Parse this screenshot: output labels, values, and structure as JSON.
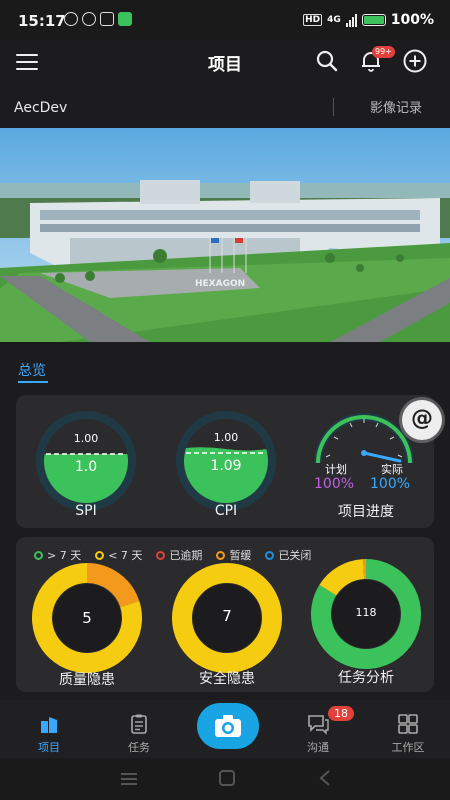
{
  "status_bar": {
    "time": "15:17",
    "battery_text": "100%",
    "hd_label": "HD",
    "network_label": "4G"
  },
  "header": {
    "title": "项目",
    "notification_badge": "99+"
  },
  "project_bar": {
    "name": "AecDev",
    "video_record": "影像记录"
  },
  "banner": {
    "sign_text": "HEXAGON"
  },
  "tabs": {
    "overview": "总览"
  },
  "metrics": {
    "spi": {
      "label": "SPI",
      "plan": "1.00",
      "value": "1.0",
      "value_num": 1.0
    },
    "cpi": {
      "label": "CPI",
      "plan": "1.00",
      "value": "1.09",
      "value_num": 1.09
    },
    "progress": {
      "label": "项目进度",
      "plan_label": "计划",
      "actual_label": "实际",
      "plan_value": "100%",
      "actual_value": "100%"
    }
  },
  "legend": [
    {
      "label": "> 7 天",
      "color": "#3cc25b"
    },
    {
      "label": "< 7 天",
      "color": "#f5cc10"
    },
    {
      "label": "已逾期",
      "color": "#e0413a"
    },
    {
      "label": "暂缓",
      "color": "#f39a1c"
    },
    {
      "label": "已关闭",
      "color": "#1e8fe1"
    }
  ],
  "chart_data": [
    {
      "type": "pie",
      "title": "质量隐患",
      "center": "5",
      "values": [
        {
          "label": "暂缓",
          "value": 1
        },
        {
          "label": "< 7 天",
          "value": 4
        }
      ]
    },
    {
      "type": "pie",
      "title": "安全隐患",
      "center": "7",
      "values": [
        {
          "label": "< 7 天",
          "value": 7
        }
      ]
    },
    {
      "type": "pie",
      "title": "任务分析",
      "center": "118",
      "values": [
        {
          "label": "> 7 天",
          "value": 99
        },
        {
          "label": "< 7 天",
          "value": 18
        },
        {
          "label": "暂缓",
          "value": 1
        }
      ]
    }
  ],
  "at_button": "@",
  "bottom_tabs": [
    {
      "label": "项目",
      "active": true
    },
    {
      "label": "任务",
      "active": false
    },
    {
      "label": "沟通",
      "active": false,
      "badge": "18"
    },
    {
      "label": "工作区",
      "active": false
    }
  ],
  "colors": {
    "accent": "#38a9ff",
    "green": "#3cc25b",
    "yellow": "#f5cc10",
    "orange": "#f39a1c",
    "purple": "#c05ee6",
    "camera": "#19a4e3"
  }
}
